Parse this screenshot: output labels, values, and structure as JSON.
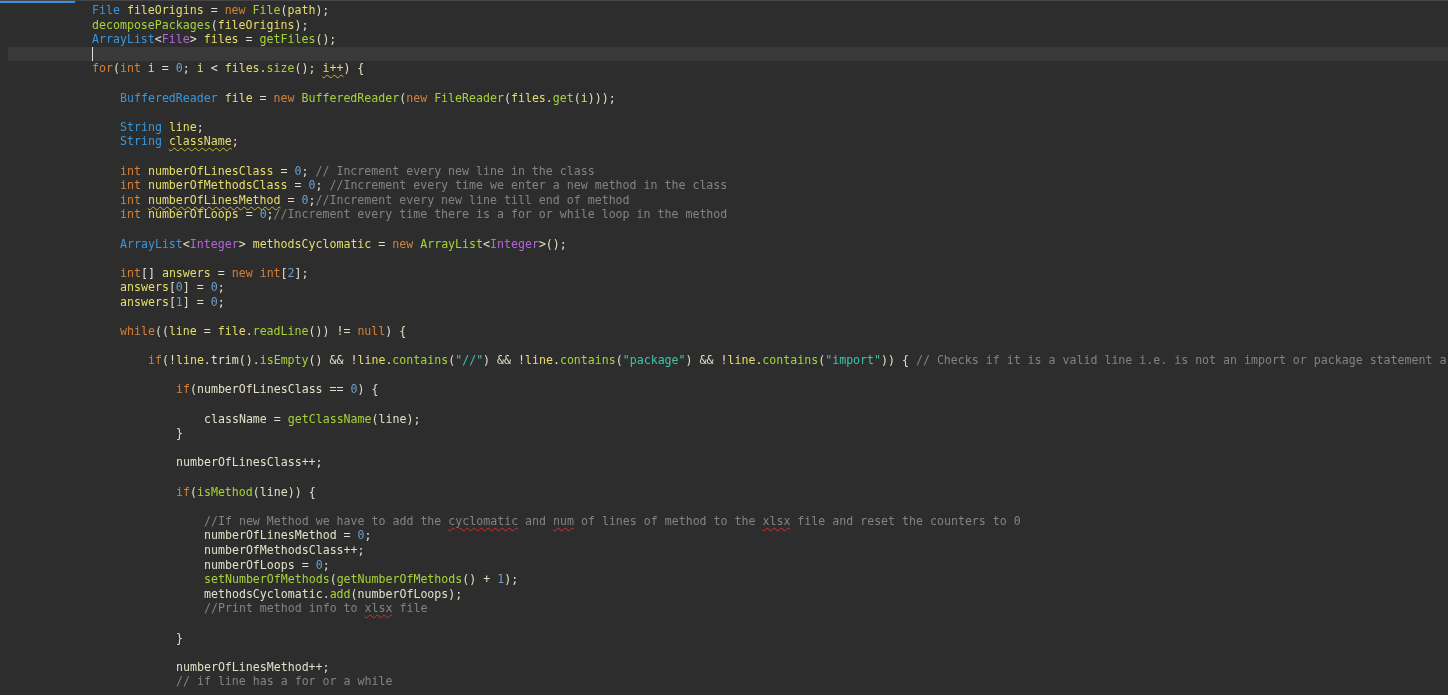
{
  "editor": {
    "lines": [
      {
        "kind": "code",
        "tokens": [
          {
            "text": "File ",
            "kind": "type"
          },
          {
            "text": "fileOrigins",
            "kind": "var"
          },
          {
            "text": " = ",
            "kind": "plain"
          },
          {
            "text": "new ",
            "kind": "keyword"
          },
          {
            "text": "File",
            "kind": "function"
          },
          {
            "text": "(",
            "kind": "plain"
          },
          {
            "text": "path",
            "kind": "var"
          },
          {
            "text": ");",
            "kind": "plain"
          }
        ]
      },
      {
        "kind": "code",
        "tokens": [
          {
            "text": "decomposePackages",
            "kind": "function"
          },
          {
            "text": "(",
            "kind": "plain"
          },
          {
            "text": "fileOrigins",
            "kind": "var"
          },
          {
            "text": ");",
            "kind": "plain"
          }
        ]
      },
      {
        "kind": "code",
        "tokens": [
          {
            "text": "ArrayList",
            "kind": "type"
          },
          {
            "text": "<",
            "kind": "plain"
          },
          {
            "text": "File",
            "kind": "generic"
          },
          {
            "text": "> ",
            "kind": "plain"
          },
          {
            "text": "files",
            "kind": "var"
          },
          {
            "text": " = ",
            "kind": "plain"
          },
          {
            "text": "getFiles",
            "kind": "function"
          },
          {
            "text": "();",
            "kind": "plain"
          }
        ]
      },
      {
        "kind": "cursor"
      },
      {
        "kind": "code",
        "tokens": [
          {
            "text": "for",
            "kind": "keyword"
          },
          {
            "text": "(",
            "kind": "plain"
          },
          {
            "text": "int ",
            "kind": "keyword"
          },
          {
            "text": "i",
            "kind": "var"
          },
          {
            "text": " = ",
            "kind": "plain"
          },
          {
            "text": "0",
            "kind": "number"
          },
          {
            "text": "; ",
            "kind": "plain"
          },
          {
            "text": "i",
            "kind": "var"
          },
          {
            "text": " < ",
            "kind": "plain"
          },
          {
            "text": "files",
            "kind": "var"
          },
          {
            "text": ".",
            "kind": "plain"
          },
          {
            "text": "size",
            "kind": "function"
          },
          {
            "text": "(); ",
            "kind": "plain"
          },
          {
            "text": "i++",
            "kind": "var",
            "underlined": true
          },
          {
            "text": ") {",
            "kind": "plain"
          }
        ],
        "children": [
          {
            "kind": "blank"
          },
          {
            "kind": "code",
            "tokens": [
              {
                "text": "BufferedReader ",
                "kind": "type"
              },
              {
                "text": "file",
                "kind": "var"
              },
              {
                "text": " = ",
                "kind": "plain"
              },
              {
                "text": "new ",
                "kind": "keyword"
              },
              {
                "text": "BufferedReader",
                "kind": "function"
              },
              {
                "text": "(",
                "kind": "plain"
              },
              {
                "text": "new ",
                "kind": "keyword"
              },
              {
                "text": "FileReader",
                "kind": "function"
              },
              {
                "text": "(",
                "kind": "plain"
              },
              {
                "text": "files",
                "kind": "var"
              },
              {
                "text": ".",
                "kind": "plain"
              },
              {
                "text": "get",
                "kind": "function"
              },
              {
                "text": "(",
                "kind": "plain"
              },
              {
                "text": "i",
                "kind": "var"
              },
              {
                "text": ")));",
                "kind": "plain"
              }
            ]
          },
          {
            "kind": "blank"
          },
          {
            "kind": "code",
            "tokens": [
              {
                "text": "String ",
                "kind": "type"
              },
              {
                "text": "line",
                "kind": "var"
              },
              {
                "text": ";",
                "kind": "plain"
              }
            ]
          },
          {
            "kind": "code",
            "tokens": [
              {
                "text": "String ",
                "kind": "type"
              },
              {
                "text": "className",
                "kind": "var",
                "underlined": true
              },
              {
                "text": ";",
                "kind": "plain"
              }
            ]
          },
          {
            "kind": "blank"
          },
          {
            "kind": "code",
            "tokens": [
              {
                "text": "int ",
                "kind": "keyword"
              },
              {
                "text": "numberOfLinesClass",
                "kind": "var"
              },
              {
                "text": " = ",
                "kind": "plain"
              },
              {
                "text": "0",
                "kind": "number"
              },
              {
                "text": "; ",
                "kind": "plain"
              },
              {
                "text": "// Increment every new line in the class",
                "kind": "comment"
              }
            ]
          },
          {
            "kind": "code",
            "tokens": [
              {
                "text": "int ",
                "kind": "keyword"
              },
              {
                "text": "numberOfMethodsClass",
                "kind": "var"
              },
              {
                "text": " = ",
                "kind": "plain"
              },
              {
                "text": "0",
                "kind": "number"
              },
              {
                "text": "; ",
                "kind": "plain"
              },
              {
                "text": "//Increment every time we enter a new method in the class",
                "kind": "comment"
              }
            ]
          },
          {
            "kind": "code",
            "tokens": [
              {
                "text": "int ",
                "kind": "keyword"
              },
              {
                "text": "numberOfLinesMethod",
                "kind": "var",
                "underlined": true
              },
              {
                "text": " = ",
                "kind": "plain"
              },
              {
                "text": "0",
                "kind": "number"
              },
              {
                "text": ";",
                "kind": "plain"
              },
              {
                "text": "//Increment every new line till end of method",
                "kind": "comment"
              }
            ]
          },
          {
            "kind": "code",
            "tokens": [
              {
                "text": "int ",
                "kind": "keyword"
              },
              {
                "text": "numberOfLoops",
                "kind": "var"
              },
              {
                "text": " = ",
                "kind": "plain"
              },
              {
                "text": "0",
                "kind": "number"
              },
              {
                "text": ";",
                "kind": "plain"
              },
              {
                "text": "//Increment every time there is a for or while loop in the method",
                "kind": "comment"
              }
            ]
          },
          {
            "kind": "blank"
          },
          {
            "kind": "code",
            "tokens": [
              {
                "text": "ArrayList",
                "kind": "type"
              },
              {
                "text": "<",
                "kind": "plain"
              },
              {
                "text": "Integer",
                "kind": "generic"
              },
              {
                "text": "> ",
                "kind": "plain"
              },
              {
                "text": "methodsCyclomatic",
                "kind": "var"
              },
              {
                "text": " = ",
                "kind": "plain"
              },
              {
                "text": "new ",
                "kind": "keyword"
              },
              {
                "text": "ArrayList",
                "kind": "function"
              },
              {
                "text": "<",
                "kind": "plain"
              },
              {
                "text": "Integer",
                "kind": "generic"
              },
              {
                "text": ">();",
                "kind": "plain"
              }
            ]
          },
          {
            "kind": "blank"
          },
          {
            "kind": "code",
            "tokens": [
              {
                "text": "int",
                "kind": "keyword"
              },
              {
                "text": "[] ",
                "kind": "plain"
              },
              {
                "text": "answers",
                "kind": "var"
              },
              {
                "text": " = ",
                "kind": "plain"
              },
              {
                "text": "new ",
                "kind": "keyword"
              },
              {
                "text": "int",
                "kind": "keyword"
              },
              {
                "text": "[",
                "kind": "plain"
              },
              {
                "text": "2",
                "kind": "number"
              },
              {
                "text": "];",
                "kind": "plain"
              }
            ]
          },
          {
            "kind": "code",
            "tokens": [
              {
                "text": "answers",
                "kind": "var"
              },
              {
                "text": "[",
                "kind": "plain"
              },
              {
                "text": "0",
                "kind": "number"
              },
              {
                "text": "] = ",
                "kind": "plain"
              },
              {
                "text": "0",
                "kind": "number"
              },
              {
                "text": ";",
                "kind": "plain"
              }
            ]
          },
          {
            "kind": "code",
            "tokens": [
              {
                "text": "answers",
                "kind": "var"
              },
              {
                "text": "[",
                "kind": "plain"
              },
              {
                "text": "1",
                "kind": "number"
              },
              {
                "text": "] = ",
                "kind": "plain"
              },
              {
                "text": "0",
                "kind": "number"
              },
              {
                "text": ";",
                "kind": "plain"
              }
            ]
          },
          {
            "kind": "blank"
          },
          {
            "kind": "code",
            "tokens": [
              {
                "text": "while",
                "kind": "keyword"
              },
              {
                "text": "((",
                "kind": "plain"
              },
              {
                "text": "line",
                "kind": "var"
              },
              {
                "text": " = ",
                "kind": "plain"
              },
              {
                "text": "file",
                "kind": "var"
              },
              {
                "text": ".",
                "kind": "plain"
              },
              {
                "text": "readLine",
                "kind": "function"
              },
              {
                "text": "()) != ",
                "kind": "plain"
              },
              {
                "text": "null",
                "kind": "keyword"
              },
              {
                "text": ") {",
                "kind": "plain"
              }
            ],
            "children": [
              {
                "kind": "blank"
              },
              {
                "kind": "code",
                "tokens": [
                  {
                    "text": "if",
                    "kind": "keyword"
                  },
                  {
                    "text": "(!",
                    "kind": "plain"
                  },
                  {
                    "text": "line",
                    "kind": "var"
                  },
                  {
                    "text": ".trim().",
                    "kind": "plain"
                  },
                  {
                    "text": "isEmpty",
                    "kind": "function"
                  },
                  {
                    "text": "() && !",
                    "kind": "plain"
                  },
                  {
                    "text": "line",
                    "kind": "var"
                  },
                  {
                    "text": ".",
                    "kind": "plain"
                  },
                  {
                    "text": "contains",
                    "kind": "function"
                  },
                  {
                    "text": "(",
                    "kind": "plain"
                  },
                  {
                    "text": "\"//\"",
                    "kind": "string"
                  },
                  {
                    "text": ") && !",
                    "kind": "plain"
                  },
                  {
                    "text": "line",
                    "kind": "var"
                  },
                  {
                    "text": ".",
                    "kind": "plain"
                  },
                  {
                    "text": "contains",
                    "kind": "function"
                  },
                  {
                    "text": "(",
                    "kind": "plain"
                  },
                  {
                    "text": "\"package\"",
                    "kind": "string"
                  },
                  {
                    "text": ") && !",
                    "kind": "plain"
                  },
                  {
                    "text": "line",
                    "kind": "var"
                  },
                  {
                    "text": ".",
                    "kind": "plain"
                  },
                  {
                    "text": "contains",
                    "kind": "function"
                  },
                  {
                    "text": "(",
                    "kind": "plain"
                  },
                  {
                    "text": "\"import\"",
                    "kind": "string"
                  },
                  {
                    "text": ")) { ",
                    "kind": "plain"
                  },
                  {
                    "text": "// Checks if it is a valid line i.e. is not an import or package statement a",
                    "kind": "comment"
                  }
                ],
                "children": [
                  {
                    "kind": "blank"
                  },
                  {
                    "kind": "code",
                    "tokens": [
                      {
                        "text": "if",
                        "kind": "keyword"
                      },
                      {
                        "text": "(numberOfLinesClass == ",
                        "kind": "plain"
                      },
                      {
                        "text": "0",
                        "kind": "number"
                      },
                      {
                        "text": ") {",
                        "kind": "plain"
                      }
                    ],
                    "children": [
                      {
                        "kind": "blank"
                      },
                      {
                        "kind": "code",
                        "tokens": [
                          {
                            "text": "className = ",
                            "kind": "plain"
                          },
                          {
                            "text": "getClassName",
                            "kind": "function"
                          },
                          {
                            "text": "(line);",
                            "kind": "plain"
                          }
                        ]
                      }
                    ]
                  },
                  {
                    "kind": "code",
                    "tokens": [
                      {
                        "text": "}",
                        "kind": "plain"
                      }
                    ]
                  },
                  {
                    "kind": "blank"
                  },
                  {
                    "kind": "code",
                    "tokens": [
                      {
                        "text": "numberOfLinesClass++;",
                        "kind": "plain"
                      }
                    ]
                  },
                  {
                    "kind": "blank"
                  },
                  {
                    "kind": "code",
                    "tokens": [
                      {
                        "text": "if",
                        "kind": "keyword"
                      },
                      {
                        "text": "(",
                        "kind": "plain"
                      },
                      {
                        "text": "isMethod",
                        "kind": "function"
                      },
                      {
                        "text": "(line)) {",
                        "kind": "plain"
                      }
                    ],
                    "children": [
                      {
                        "kind": "blank"
                      },
                      {
                        "kind": "code",
                        "tokens": [
                          {
                            "text": "//If new Method we have to add the ",
                            "kind": "comment"
                          },
                          {
                            "text": "cyclomatic",
                            "kind": "comment",
                            "underlined": true
                          },
                          {
                            "text": " and ",
                            "kind": "comment"
                          },
                          {
                            "text": "num",
                            "kind": "comment",
                            "underlined": true
                          },
                          {
                            "text": " of lines of method to the ",
                            "kind": "comment"
                          },
                          {
                            "text": "xlsx",
                            "kind": "comment",
                            "underlined": true
                          },
                          {
                            "text": " file and reset the counters to 0",
                            "kind": "comment"
                          }
                        ]
                      },
                      {
                        "kind": "code",
                        "tokens": [
                          {
                            "text": "numberOfLinesMethod = ",
                            "kind": "plain"
                          },
                          {
                            "text": "0",
                            "kind": "number"
                          },
                          {
                            "text": ";",
                            "kind": "plain"
                          }
                        ]
                      },
                      {
                        "kind": "code",
                        "tokens": [
                          {
                            "text": "numberOfMethodsClass++;",
                            "kind": "plain"
                          }
                        ]
                      },
                      {
                        "kind": "code",
                        "tokens": [
                          {
                            "text": "numberOfLoops = ",
                            "kind": "plain"
                          },
                          {
                            "text": "0",
                            "kind": "number"
                          },
                          {
                            "text": ";",
                            "kind": "plain"
                          }
                        ]
                      },
                      {
                        "kind": "code",
                        "tokens": [
                          {
                            "text": "setNumberOfMethods",
                            "kind": "function"
                          },
                          {
                            "text": "(",
                            "kind": "plain"
                          },
                          {
                            "text": "getNumberOfMethods",
                            "kind": "function"
                          },
                          {
                            "text": "() + ",
                            "kind": "plain"
                          },
                          {
                            "text": "1",
                            "kind": "number"
                          },
                          {
                            "text": ");",
                            "kind": "plain"
                          }
                        ]
                      },
                      {
                        "kind": "code",
                        "tokens": [
                          {
                            "text": "methodsCyclomatic.",
                            "kind": "plain"
                          },
                          {
                            "text": "add",
                            "kind": "function"
                          },
                          {
                            "text": "(numberOfLoops);",
                            "kind": "plain"
                          }
                        ]
                      },
                      {
                        "kind": "code",
                        "tokens": [
                          {
                            "text": "//Print method info to ",
                            "kind": "comment"
                          },
                          {
                            "text": "xlsx",
                            "kind": "comment",
                            "underlined": true
                          },
                          {
                            "text": " file",
                            "kind": "comment"
                          }
                        ]
                      },
                      {
                        "kind": "blank"
                      }
                    ]
                  },
                  {
                    "kind": "code",
                    "tokens": [
                      {
                        "text": "}",
                        "kind": "plain"
                      }
                    ]
                  },
                  {
                    "kind": "blank"
                  },
                  {
                    "kind": "code",
                    "tokens": [
                      {
                        "text": "numberOfLinesMethod++;",
                        "kind": "plain"
                      }
                    ]
                  },
                  {
                    "kind": "code",
                    "tokens": [
                      {
                        "text": "// if line has a for or a while",
                        "kind": "comment"
                      }
                    ]
                  }
                ]
              }
            ]
          }
        ]
      }
    ]
  }
}
